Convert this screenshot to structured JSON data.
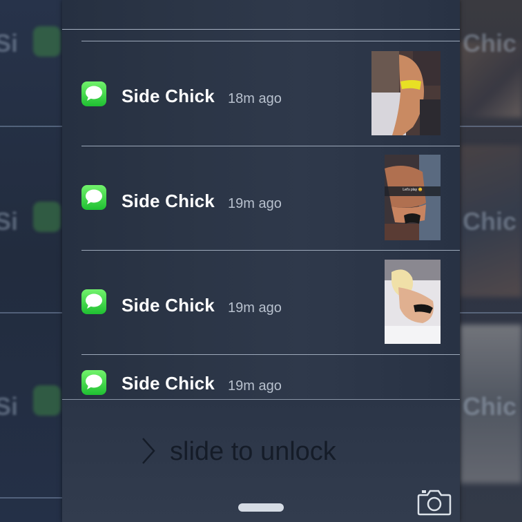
{
  "notifications": [
    {
      "sender": "Side Chick",
      "time": "18m ago",
      "has_image": true
    },
    {
      "sender": "Side Chick",
      "time": "19m ago",
      "has_image": true,
      "image_caption": "Let's play 😊"
    },
    {
      "sender": "Side Chick",
      "time": "19m ago",
      "has_image": true
    },
    {
      "sender": "Side Chick",
      "time": "19m ago",
      "has_image": false
    }
  ],
  "lock_screen": {
    "slide_to_unlock": "slide to unlock",
    "icons": {
      "message": "messages-app-icon",
      "chevron": "chevron-right-icon",
      "camera": "camera-icon",
      "grabber": "control-center-grabber"
    }
  },
  "colors": {
    "panel_background": "#2b3546",
    "messages_green": "#2fd044",
    "sender_text": "#ffffff",
    "time_text": "#b8c1ce"
  }
}
